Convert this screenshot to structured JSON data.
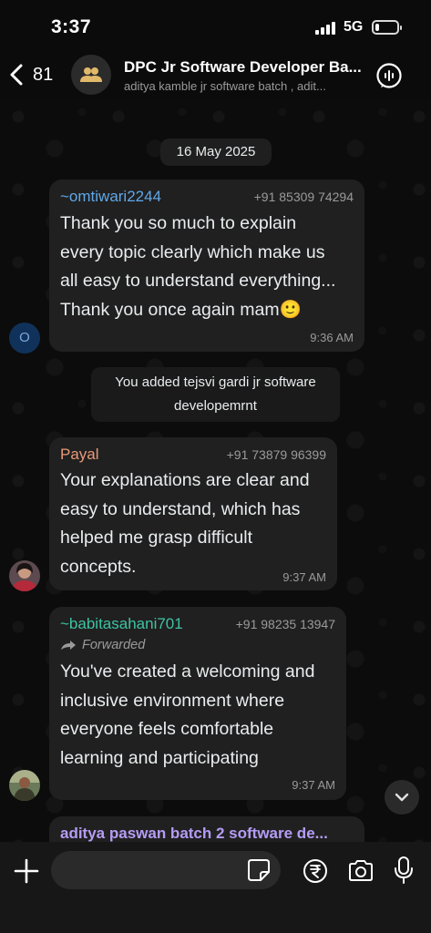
{
  "status_bar": {
    "time": "3:37",
    "network": "5G",
    "battery_level_fraction": 0.2
  },
  "header": {
    "back_count": "81",
    "title": "DPC Jr Software Developer Ba...",
    "subtitle": "aditya kamble jr software batch , adit..."
  },
  "date_separator": "16 May 2025",
  "messages": [
    {
      "sender": "~omtiwari2244",
      "sender_color": "#5fa8e8",
      "phone": "+91 85309 74294",
      "lines": [
        "Thank you so much to explain",
        "every topic clearly which make us",
        "all easy to understand everything...",
        "Thank you once again mam🙂"
      ],
      "time": "9:36 AM",
      "avatar_letter": "O"
    },
    {
      "system": true,
      "lines": [
        "You added tejsvi gardi jr software",
        "developemrnt"
      ]
    },
    {
      "sender": "Payal",
      "sender_color": "#e89a7a",
      "phone": "+91 73879 96399",
      "lines": [
        "Your explanations are clear and",
        "easy to understand, which has",
        "helped me grasp difficult",
        "concepts."
      ],
      "time": "9:37 AM"
    },
    {
      "sender": "~babitasahani701",
      "sender_color": "#3ec3a3",
      "phone": "+91 98235 13947",
      "forwarded": "Forwarded",
      "lines": [
        "You've created a welcoming and",
        "inclusive environment where",
        "everyone feels comfortable",
        "learning and participating"
      ],
      "time": "9:37 AM"
    },
    {
      "sender": "aditya paswan batch 2 software de...",
      "sender_color": "#b59cf5",
      "partial": true
    }
  ],
  "input": {
    "placeholder": ""
  },
  "icons": {
    "back": "chevron-left-icon",
    "group": "group-people-icon",
    "call": "voice-call-icon",
    "scroll": "chevron-down-icon",
    "plus": "plus-icon",
    "sticker": "sticker-icon",
    "payment": "rupee-icon",
    "camera": "camera-icon",
    "mic": "microphone-icon"
  }
}
